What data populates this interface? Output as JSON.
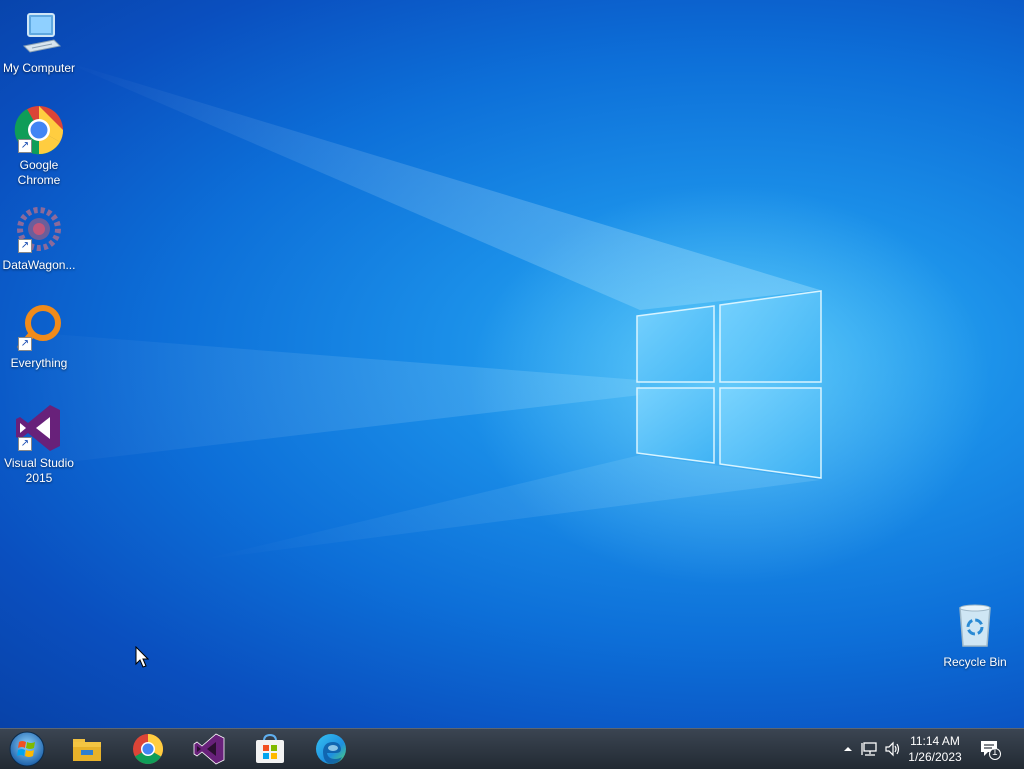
{
  "desktop": {
    "icons": [
      {
        "name": "my-computer",
        "label": "My Computer",
        "shortcut": false
      },
      {
        "name": "google-chrome",
        "label": "Google\nChrome",
        "shortcut": true
      },
      {
        "name": "datawagon",
        "label": "DataWagon...",
        "shortcut": true
      },
      {
        "name": "everything",
        "label": "Everything",
        "shortcut": true
      },
      {
        "name": "visual-studio-2015",
        "label": "Visual Studio\n2015",
        "shortcut": true
      },
      {
        "name": "recycle-bin",
        "label": "Recycle Bin",
        "shortcut": false
      }
    ]
  },
  "taskbar": {
    "start_icon": "windows-orb-icon",
    "pinned": [
      {
        "name": "file-explorer",
        "icon": "folder-icon"
      },
      {
        "name": "chrome",
        "icon": "chrome-icon"
      },
      {
        "name": "visual-studio",
        "icon": "visual-studio-icon"
      },
      {
        "name": "microsoft-store",
        "icon": "store-icon"
      },
      {
        "name": "edge",
        "icon": "edge-icon"
      }
    ],
    "tray": {
      "chevron_icon": "chevron-up-icon",
      "network_icon": "network-icon",
      "volume_icon": "volume-icon",
      "time": "11:14 AM",
      "date": "1/26/2023",
      "notification_count": "1"
    }
  },
  "colors": {
    "taskbar": "#2a323c",
    "desktop_accent": "#1a8ee8"
  }
}
